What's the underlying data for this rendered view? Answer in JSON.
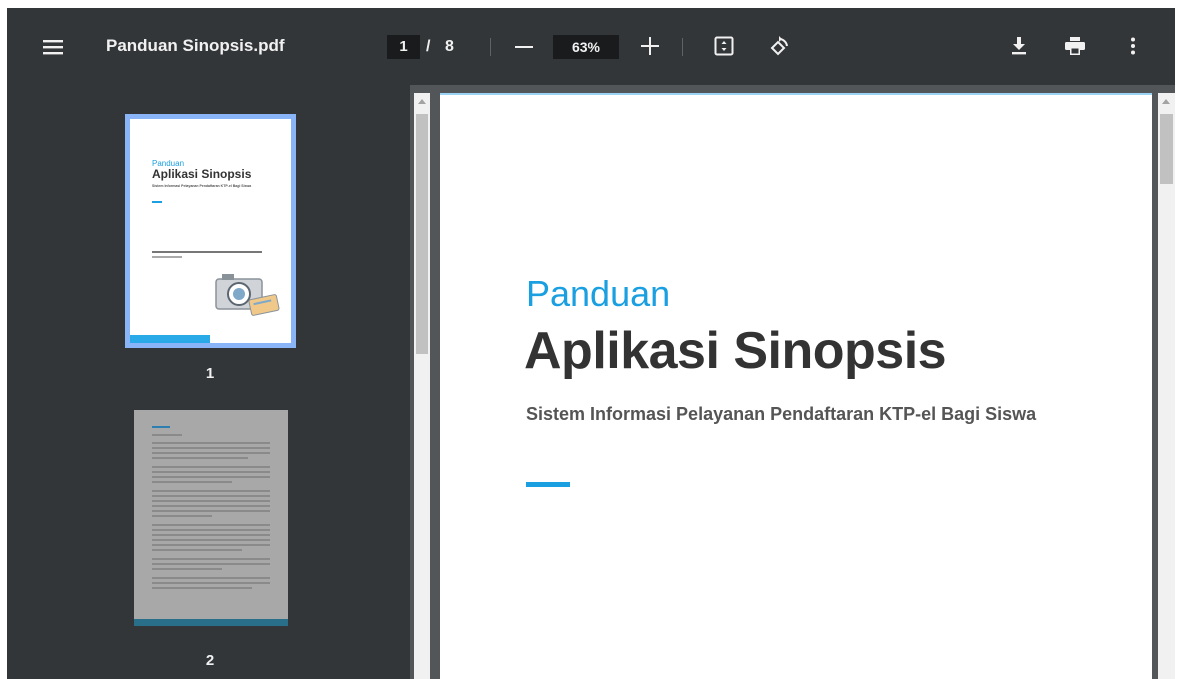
{
  "toolbar": {
    "title": "Panduan Sinopsis.pdf",
    "current_page": "1",
    "page_separator": "/",
    "total_pages": "8",
    "zoom": "63%"
  },
  "icons": [
    "menu-icon",
    "minus-icon",
    "plus-icon",
    "fit-page-icon",
    "rotate-icon",
    "download-icon",
    "print-icon",
    "more-vert-icon"
  ],
  "sidebar": {
    "thumbnails": [
      {
        "label": "1",
        "selected": true
      },
      {
        "label": "2",
        "selected": false
      }
    ],
    "mini_page1": {
      "kicker": "Panduan",
      "title": "Aplikasi Sinopsis",
      "subtitle": "Sistem Informasi Pelayanan Pendaftaran KTP-el Bagi Siswa"
    }
  },
  "document": {
    "kicker": "Panduan",
    "title": "Aplikasi Sinopsis",
    "subtitle": "Sistem Informasi Pelayanan Pendaftaran KTP-el Bagi Siswa"
  },
  "colors": {
    "accent": "#1a9fe0",
    "toolbar_bg": "#323639",
    "thumb_selected": "#8ab4f8"
  }
}
